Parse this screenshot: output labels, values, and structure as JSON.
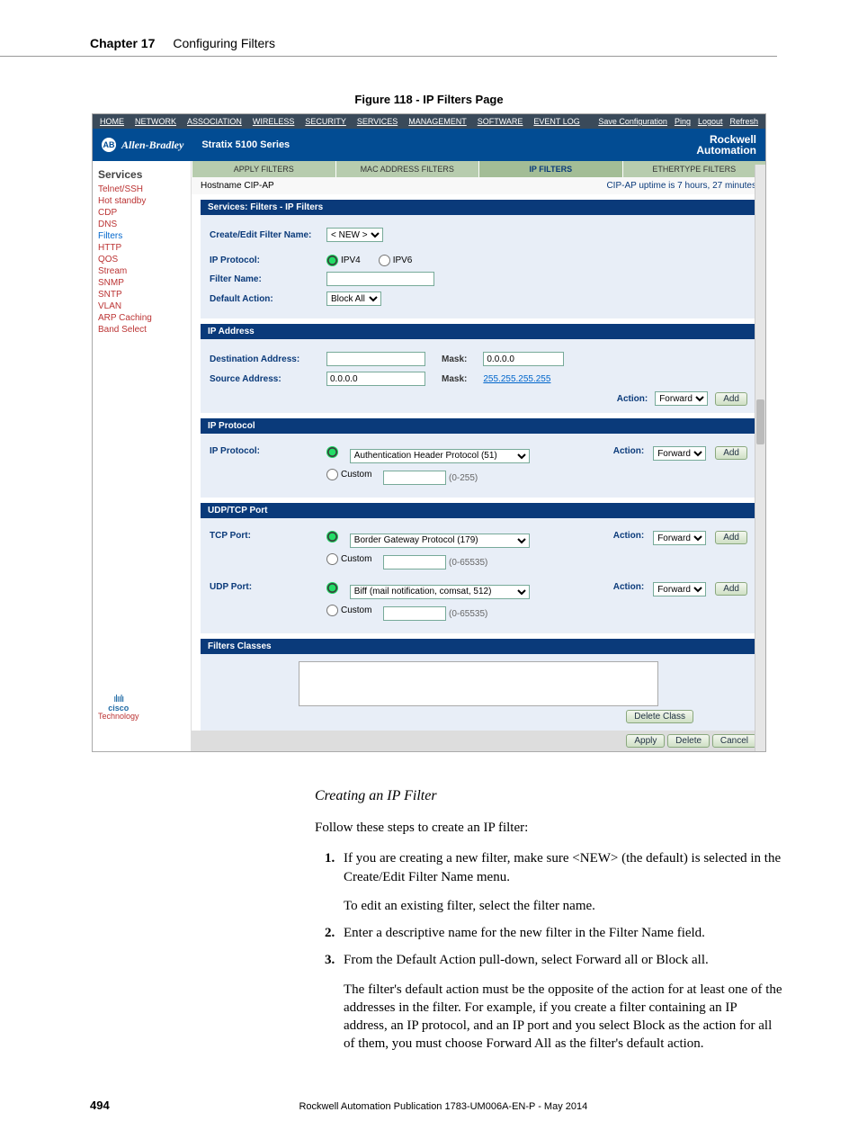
{
  "header": {
    "chapter_label": "Chapter 17",
    "chapter_title": "Configuring Filters"
  },
  "figure_caption": "Figure 118 - IP Filters Page",
  "shot": {
    "topnav": [
      "HOME",
      "NETWORK",
      "ASSOCIATION",
      "WIRELESS",
      "SECURITY",
      "SERVICES",
      "MANAGEMENT",
      "SOFTWARE",
      "EVENT LOG"
    ],
    "topnav_right": [
      "Save Configuration",
      "Ping",
      "Logout",
      "Refresh"
    ],
    "brand_ab": "AB",
    "brand_name": "Allen-Bradley",
    "series": "Stratix 5100 Series",
    "rockwell1": "Rockwell",
    "rockwell2": "Automation",
    "sidebar_header": "Services",
    "sidebar_items": [
      "Telnet/SSH",
      "Hot standby",
      "CDP",
      "DNS",
      "Filters",
      "HTTP",
      "QOS",
      "Stream",
      "SNMP",
      "SNTP",
      "VLAN",
      "ARP Caching",
      "Band Select"
    ],
    "tabs": [
      "APPLY FILTERS",
      "MAC ADDRESS FILTERS",
      "IP FILTERS",
      "ETHERTYPE FILTERS"
    ],
    "hostname_label": "Hostname CIP-AP",
    "uptime": "CIP-AP uptime is 7 hours, 27 minutes",
    "sec_filters_title": "Services: Filters - IP Filters",
    "create_label": "Create/Edit Filter Name:",
    "create_value": "< NEW >",
    "ipproto_label": "IP Protocol:",
    "ipv4": "IPV4",
    "ipv6": "IPV6",
    "filtername_label": "Filter Name:",
    "defaultaction_label": "Default Action:",
    "defaultaction_value": "Block All",
    "sec_ipaddr_title": "IP Address",
    "destaddr_label": "Destination Address:",
    "srcaddr_label": "Source Address:",
    "srcaddr_value": "0.0.0.0",
    "mask_label": "Mask:",
    "mask_dest": "0.0.0.0",
    "mask_src": "255.255.255.255",
    "action_label": "Action:",
    "forward": "Forward",
    "add": "Add",
    "sec_ipproto_title": "IP Protocol",
    "proto_select": "Authentication Header Protocol (51)",
    "custom": "Custom",
    "proto_range": "(0-255)",
    "sec_udptcp_title": "UDP/TCP Port",
    "tcpport_label": "TCP Port:",
    "tcp_select": "Border Gateway Protocol (179)",
    "port_range": "(0-65535)",
    "udpport_label": "UDP Port:",
    "udp_select": "Biff (mail notification, comsat, 512)",
    "sec_classes_title": "Filters Classes",
    "delete_class": "Delete Class",
    "apply": "Apply",
    "delete": "Delete",
    "cancel": "Cancel",
    "cisco": "cisco",
    "tech": "Technology"
  },
  "body": {
    "subhead": "Creating an IP Filter",
    "intro": "Follow these steps to create an IP filter:",
    "step1": "If you are creating a new filter, make sure <NEW> (the default) is selected in the Create/Edit Filter Name menu.",
    "step1b": "To edit an existing filter, select the filter name.",
    "step2": "Enter a descriptive name for the new filter in the Filter Name field.",
    "step3": "From the Default Action pull-down, select Forward all or Block all.",
    "step3b": "The filter's default action must be the opposite of the action for at least one of the addresses in the filter. For example, if you create a filter containing an IP address, an IP protocol, and an IP port and you select Block as the action for all of them, you must choose Forward All as the filter's default action."
  },
  "footer": {
    "page": "494",
    "pub": "Rockwell Automation Publication 1783-UM006A-EN-P - May 2014"
  }
}
